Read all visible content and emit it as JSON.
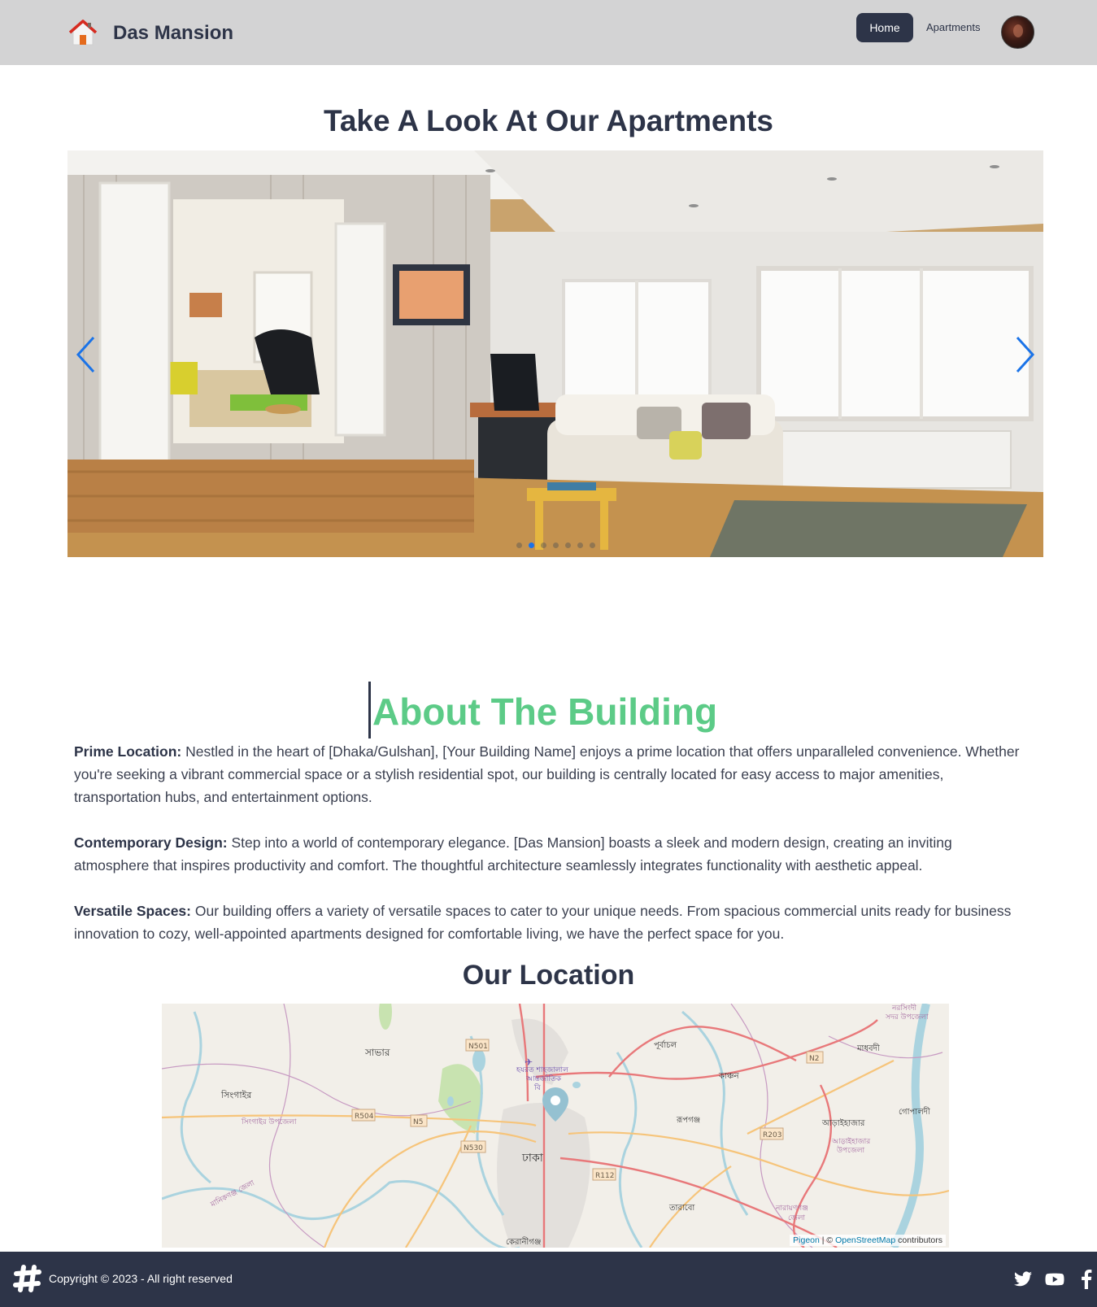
{
  "header": {
    "brand": "Das Mansion",
    "logo_icon": "house-icon",
    "nav": {
      "home": "Home",
      "apartments": "Apartments"
    },
    "avatar_icon": "user-avatar"
  },
  "gallery": {
    "title": "Take A Look At Our Apartments",
    "slide_count": 7,
    "active_slide": 2,
    "prev_icon": "chevron-left-icon",
    "next_icon": "chevron-right-icon",
    "arrow_color": "#1a73e8"
  },
  "about": {
    "title": "About The Building",
    "paragraphs": [
      {
        "label": "Prime Location:",
        "text": " Nestled in the heart of [Dhaka/Gulshan], [Your Building Name] enjoys a prime location that offers unparalleled convenience. Whether you're seeking a vibrant commercial space or a stylish residential spot, our building is centrally located for easy access to major amenities, transportation hubs, and entertainment options."
      },
      {
        "label": "Contemporary Design:",
        "text": " Step into a world of contemporary elegance. [Das Mansion] boasts a sleek and modern design, creating an inviting atmosphere that inspires productivity and comfort. The thoughtful architecture seamlessly integrates functionality with aesthetic appeal."
      },
      {
        "label": "Versatile Spaces:",
        "text": " Our building offers a variety of versatile spaces to cater to your unique needs. From spacious commercial units ready for business innovation to cozy, well-appointed apartments designed for comfortable living, we have the perfect space for you."
      }
    ]
  },
  "location": {
    "title": "Our Location",
    "map_labels": {
      "savar": "সাভার",
      "singair": "সিংগাইর",
      "singair_upazila": "সিংগাইর উপজেলা",
      "airport_1": "হযরত শাহজালাল",
      "airport_2": "আন্তর্জাতিক",
      "airport_3": "বি",
      "dhaka": "ঢাকা",
      "purbachal": "পূর্বাচল",
      "kanchan": "কাঞ্চন",
      "rupganj": "রূপগঞ্জ",
      "araihazar": "আড়াইহাজার",
      "araihazar_upazila_1": "আড়াইহাজার",
      "araihazar_upazila_2": "উপজেলা",
      "madhabdi": "মাধবদী",
      "gopaldi": "গোপালদী",
      "narsingdi_1": "নরসিংদী",
      "narsingdi_2": "সদর উপজেলা",
      "tarabo": "তারাবো",
      "narayanganj_1": "নারায়ণগঞ্জ",
      "narayanganj_2": "জেলা",
      "keraniganj": "কেরানীগঞ্জ",
      "manikganj": "মানিকগঞ্জ জেলা",
      "road_n501": "N501",
      "road_n2": "N2",
      "road_r504": "R504",
      "road_n5": "N5",
      "road_n530": "N530",
      "road_r112": "R112",
      "road_r203": "R203"
    },
    "marker_icon": "map-pin-icon",
    "attribution": {
      "pigeon": "Pigeon",
      "sep": " | © ",
      "osm": "OpenStreetMap",
      "contrib": " contributors"
    }
  },
  "footer": {
    "logo_icon": "hashtag-logo-icon",
    "copyright": "Copyright © 2023 - All right reserved",
    "social": [
      "twitter-icon",
      "youtube-icon",
      "facebook-icon"
    ]
  },
  "colors": {
    "navbar_bg": "#d3d3d4",
    "primary_dark": "#2d3448",
    "accent_green": "#5ccb87",
    "carousel_active_dot": "#1a73e8"
  }
}
